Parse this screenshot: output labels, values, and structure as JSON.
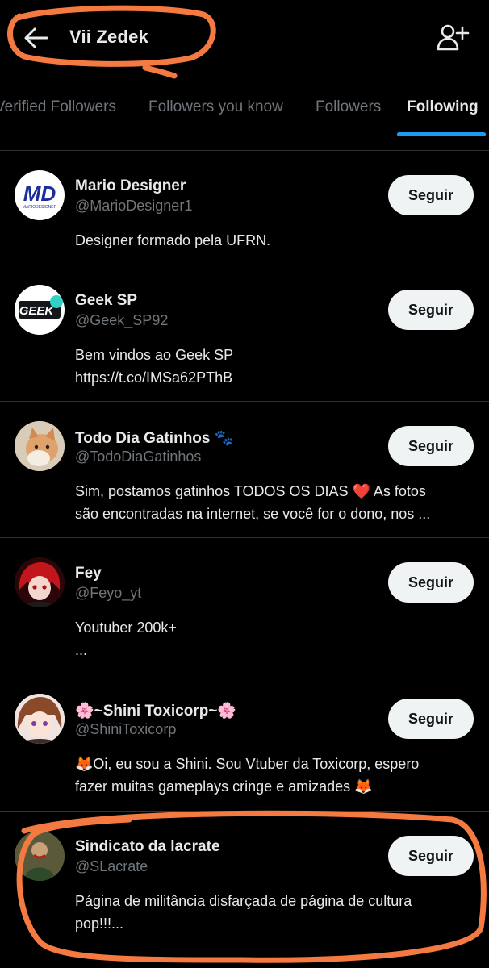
{
  "header": {
    "title": "Vii Zedek",
    "back_icon": "arrow-left-icon",
    "add_icon": "person-add-icon"
  },
  "tabs": [
    {
      "label": "Verified Followers",
      "active": false
    },
    {
      "label": "Followers you know",
      "active": false
    },
    {
      "label": "Followers",
      "active": false
    },
    {
      "label": "Following",
      "active": true
    }
  ],
  "accounts": [
    {
      "name": "Mario Designer",
      "handle": "@MarioDesigner1",
      "bio": [
        "Designer formado pela UFRN."
      ],
      "button": "Seguir",
      "avatar_text": "MD",
      "avatar_subtext": "MARIODESIGNER"
    },
    {
      "name": "Geek SP",
      "handle": "@Geek_SP92",
      "bio": [
        "Bem vindos ao Geek SP",
        "https://t.co/IMSa62PThB"
      ],
      "button": "Seguir",
      "avatar_text": "GEEK"
    },
    {
      "name": "Todo Dia Gatinhos 🐾",
      "handle": "@TodoDiaGatinhos",
      "bio": [
        "Sim, postamos gatinhos TODOS OS DIAS ❤️ As fotos",
        "são encontradas na internet, se você for o dono, nos ..."
      ],
      "button": "Seguir"
    },
    {
      "name": "Fey",
      "handle": "@Feyo_yt",
      "bio": [
        "Youtuber 200k+",
        "..."
      ],
      "button": "Seguir"
    },
    {
      "name": "🌸~Shini Toxicorp~🌸",
      "handle": "@ShiniToxicorp",
      "bio": [
        "🦊Oi, eu sou a Shini.  Sou Vtuber da Toxicorp, espero",
        "fazer muitas gameplays cringe e amizades 🦊"
      ],
      "button": "Seguir"
    },
    {
      "name": "Sindicato da lacrate",
      "handle": "@SLacrate",
      "bio": [
        "Página de militância disfarçada de página de cultura",
        "pop!!!..."
      ],
      "button": "Seguir"
    }
  ],
  "colors": {
    "background": "#000000",
    "text": "#e7e9ea",
    "muted": "#71767b",
    "accent": "#1d9bf0",
    "annotation": "#f47a42"
  }
}
